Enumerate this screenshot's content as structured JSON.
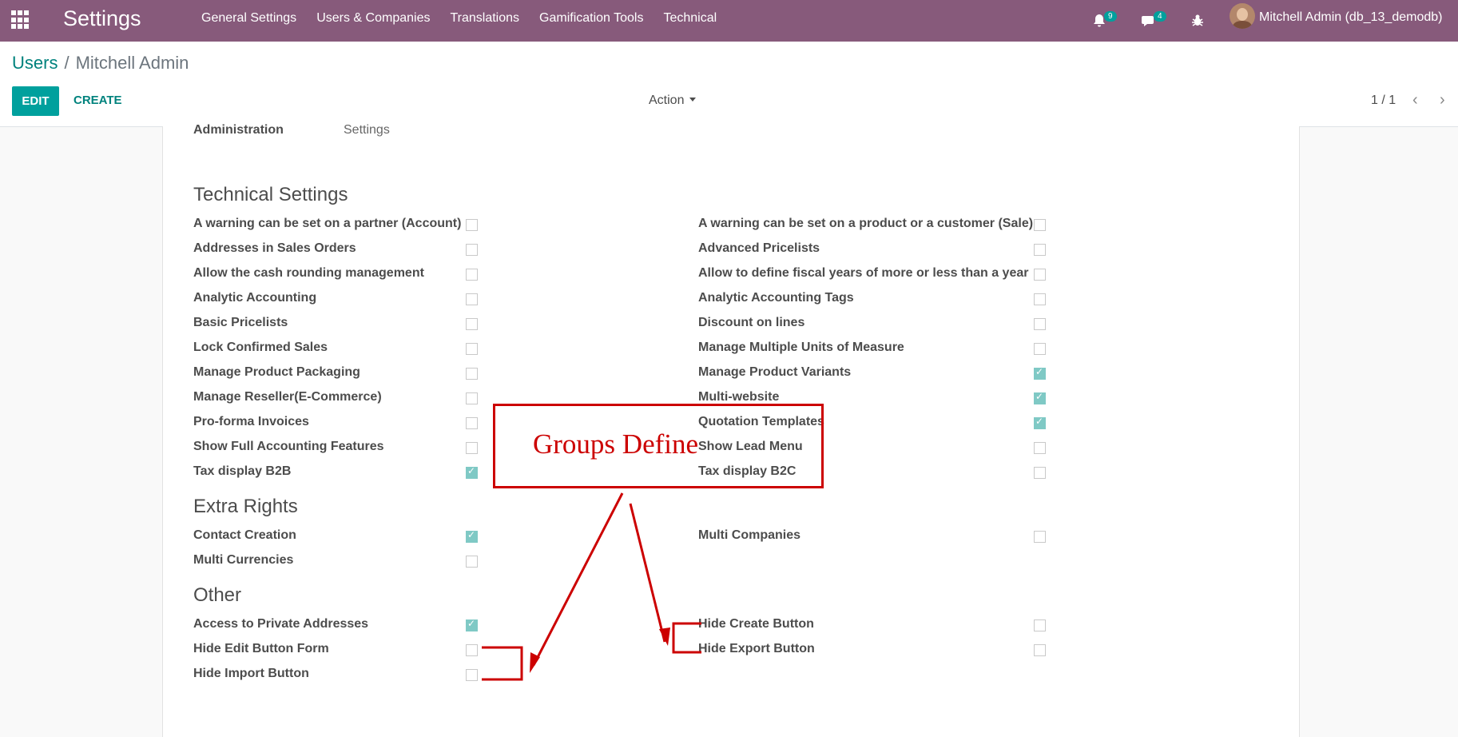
{
  "topbar": {
    "app_title": "Settings",
    "menu": [
      "General Settings",
      "Users & Companies",
      "Translations",
      "Gamification Tools",
      "Technical"
    ],
    "notifications_count": "9",
    "messages_count": "4",
    "user": "Mitchell Admin (db_13_demodb)"
  },
  "control": {
    "breadcrumb_parent": "Users",
    "breadcrumb_sep": "/",
    "breadcrumb_current": "Mitchell Admin",
    "edit_label": "EDIT",
    "create_label": "CREATE",
    "action_label": "Action",
    "pager": "1 / 1"
  },
  "cut_row": {
    "label": "Administration",
    "value": "Settings"
  },
  "sections": {
    "technical": "Technical Settings",
    "extra": "Extra Rights",
    "other": "Other"
  },
  "technical_left": [
    {
      "label": "A warning can be set on a partner (Account)",
      "checked": false
    },
    {
      "label": "Addresses in Sales Orders",
      "checked": false
    },
    {
      "label": "Allow the cash rounding management",
      "checked": false
    },
    {
      "label": "Analytic Accounting",
      "checked": false
    },
    {
      "label": "Basic Pricelists",
      "checked": false
    },
    {
      "label": "Lock Confirmed Sales",
      "checked": false
    },
    {
      "label": "Manage Product Packaging",
      "checked": false
    },
    {
      "label": "Manage Reseller(E-Commerce)",
      "checked": false
    },
    {
      "label": "Pro-forma Invoices",
      "checked": false
    },
    {
      "label": "Show Full Accounting Features",
      "checked": false
    },
    {
      "label": "Tax display B2B",
      "checked": true
    }
  ],
  "technical_right": [
    {
      "label": "A warning can be set on a product or a customer (Sale)",
      "checked": false
    },
    {
      "label": "Advanced Pricelists",
      "checked": false
    },
    {
      "label": "Allow to define fiscal years of more or less than a year",
      "checked": false
    },
    {
      "label": "Analytic Accounting Tags",
      "checked": false
    },
    {
      "label": "Discount on lines",
      "checked": false
    },
    {
      "label": "Manage Multiple Units of Measure",
      "checked": false
    },
    {
      "label": "Manage Product Variants",
      "checked": true
    },
    {
      "label": "Multi-website",
      "checked": true
    },
    {
      "label": "Quotation Templates",
      "checked": true
    },
    {
      "label": "Show Lead Menu",
      "checked": false
    },
    {
      "label": "Tax display B2C",
      "checked": false
    }
  ],
  "extra_left": [
    {
      "label": "Contact Creation",
      "checked": true
    },
    {
      "label": "Multi Currencies",
      "checked": false
    }
  ],
  "extra_right": [
    {
      "label": "Multi Companies",
      "checked": false
    }
  ],
  "other_left": [
    {
      "label": "Access to Private Addresses",
      "checked": true
    },
    {
      "label": "Hide Edit Button Form",
      "checked": false
    },
    {
      "label": "Hide Import Button",
      "checked": false
    }
  ],
  "other_right": [
    {
      "label": "Hide Create Button",
      "checked": false
    },
    {
      "label": "Hide Export Button",
      "checked": false
    }
  ],
  "annotation": "Groups Define",
  "colors": {
    "navbar": "#875a7b",
    "accent": "#00a09d",
    "annotation": "#cc0000"
  }
}
